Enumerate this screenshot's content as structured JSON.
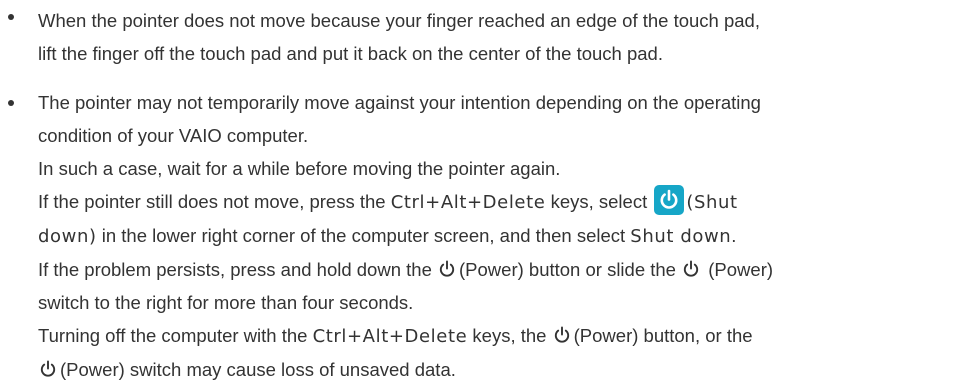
{
  "bullet1": {
    "line1": "When the pointer does not move because your finger reached an edge of the touch pad,",
    "line2": "lift the finger off the touch pad and put it back on the center of the touch pad."
  },
  "bullet2": {
    "line1": "The pointer may not temporarily move against your intention depending on the operating",
    "line2": "condition of your VAIO computer.",
    "line3": "In such a case, wait for a while before moving the pointer again.",
    "line4_a": "If the pointer still does not move, press the ",
    "keys_ctrl_alt_delete": "Ctrl+Alt+Delete",
    "line4_b": " keys, select ",
    "shut_label_a": "(Shut",
    "shut_label_b": "down)",
    "line5_b": " in the lower right corner of the computer screen, and then select ",
    "shut_down": "Shut down",
    "line5_end": ".",
    "line6_a": "If the problem persists, press and hold down the ",
    "power_label": "(Power)",
    "line6_b": " button or slide the ",
    "line6_c": " (Power)",
    "line7": "switch to the right for more than four seconds.",
    "line8_a": "Turning off the computer with the ",
    "line8_b": " keys, the ",
    "line8_c": " button, or the",
    "line9_b": " switch may cause loss of unsaved data."
  },
  "icons": {
    "power": "power-icon",
    "shutdown": "shutdown-icon"
  },
  "colors": {
    "text": "#333333",
    "shutdown_button": "#16a6c7"
  }
}
